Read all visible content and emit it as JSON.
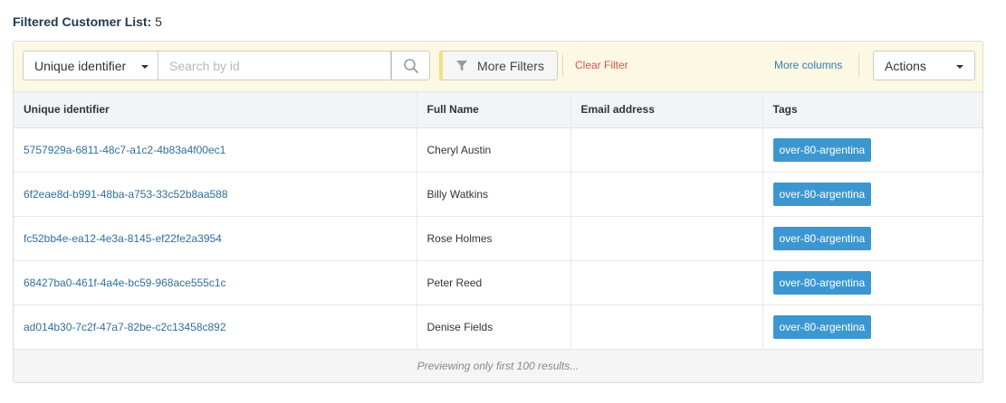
{
  "header": {
    "title": "Filtered Customer List:",
    "count": "5"
  },
  "toolbar": {
    "id_select": "Unique identifier",
    "search_placeholder": "Search by id",
    "more_filters": "More Filters",
    "clear_filter": "Clear Filter",
    "more_columns": "More columns",
    "actions": "Actions"
  },
  "table": {
    "columns": [
      "Unique identifier",
      "Full Name",
      "Email address",
      "Tags"
    ],
    "rows": [
      {
        "uid": "5757929a-6811-48c7-a1c2-4b83a4f00ec1",
        "name": "Cheryl Austin",
        "email": "",
        "tag": "over-80-argentina"
      },
      {
        "uid": "6f2eae8d-b991-48ba-a753-33c52b8aa588",
        "name": "Billy Watkins",
        "email": "",
        "tag": "over-80-argentina"
      },
      {
        "uid": "fc52bb4e-ea12-4e3a-8145-ef22fe2a3954",
        "name": "Rose Holmes",
        "email": "",
        "tag": "over-80-argentina"
      },
      {
        "uid": "68427ba0-461f-4a4e-bc59-968ace555c1c",
        "name": "Peter Reed",
        "email": "",
        "tag": "over-80-argentina"
      },
      {
        "uid": "ad014b30-7c2f-47a7-82be-c2c13458c892",
        "name": "Denise Fields",
        "email": "",
        "tag": "over-80-argentina"
      }
    ]
  },
  "footer": {
    "note": "Previewing only first 100 results..."
  },
  "colors": {
    "toolbar_bg": "#fcf8e3",
    "link": "#2f6f9f",
    "tag_bg": "#3c97d1",
    "clear_filter": "#d9534f"
  }
}
